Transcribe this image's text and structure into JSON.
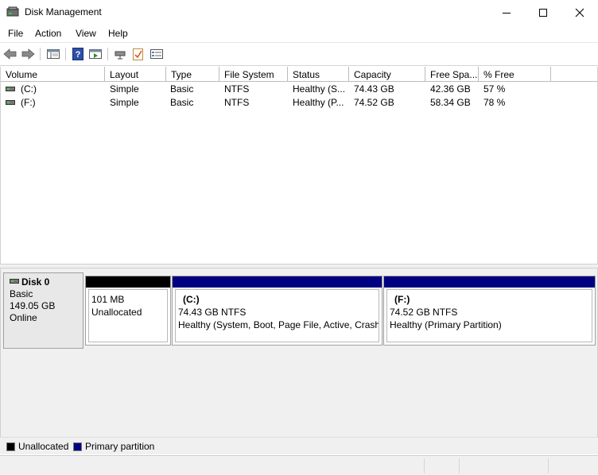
{
  "window": {
    "title": "Disk Management",
    "icon": "disk-management-icon"
  },
  "menu": [
    "File",
    "Action",
    "View",
    "Help"
  ],
  "toolbar": [
    "back-arrow-icon",
    "forward-arrow-icon",
    "show-hide-console-tree-icon",
    "help-icon",
    "properties-pane-icon",
    "connect-drive-icon",
    "check-icon",
    "details-list-icon"
  ],
  "volume_table": {
    "columns": [
      "Volume",
      "Layout",
      "Type",
      "File System",
      "Status",
      "Capacity",
      "Free Spa...",
      "% Free"
    ],
    "rows": [
      [
        "(C:)",
        "Simple",
        "Basic",
        "NTFS",
        "Healthy (S...",
        "74.43 GB",
        "42.36 GB",
        "57 %"
      ],
      [
        "(F:)",
        "Simple",
        "Basic",
        "NTFS",
        "Healthy (P...",
        "74.52 GB",
        "58.34 GB",
        "78 %"
      ]
    ]
  },
  "disk": {
    "name": "Disk 0",
    "type": "Basic",
    "size": "149.05 GB",
    "state": "Online",
    "partitions": [
      {
        "kind": "unallocated",
        "label": "",
        "size": "101 MB",
        "status": "Unallocated",
        "bar_color": "#000000"
      },
      {
        "kind": "primary",
        "label": "(C:)",
        "size": "74.43 GB NTFS",
        "status": "Healthy (System, Boot, Page File, Active, Crash Dump, Primary Partition)",
        "bar_color": "#000080"
      },
      {
        "kind": "primary",
        "label": "(F:)",
        "size": "74.52 GB NTFS",
        "status": "Healthy (Primary Partition)",
        "bar_color": "#000080"
      }
    ]
  },
  "legend": [
    {
      "label": "Unallocated",
      "color": "#000000"
    },
    {
      "label": "Primary partition",
      "color": "#000080"
    }
  ]
}
